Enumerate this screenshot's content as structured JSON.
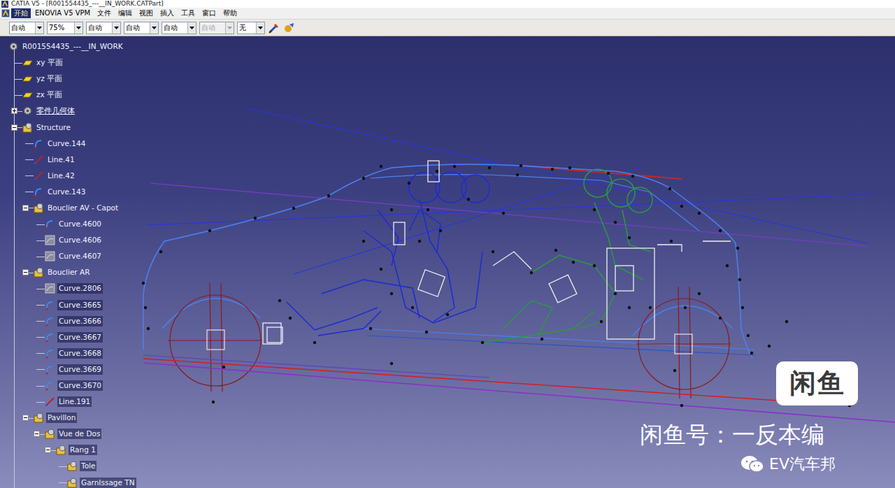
{
  "window": {
    "title": "CATIA V5 - [R001554435_---__IN_WORK.CATPart]"
  },
  "menu": [
    {
      "label": "开始",
      "selected": true
    },
    {
      "label": "ENOVIA V5 VPM",
      "selected": false
    },
    {
      "label": "文件",
      "selected": false
    },
    {
      "label": "编辑",
      "selected": false
    },
    {
      "label": "视图",
      "selected": false
    },
    {
      "label": "插入",
      "selected": false
    },
    {
      "label": "工具",
      "selected": false
    },
    {
      "label": "窗口",
      "selected": false
    },
    {
      "label": "帮助",
      "selected": false
    }
  ],
  "toolbar": {
    "combos": [
      {
        "value": "自动",
        "disabled": false
      },
      {
        "value": "75%",
        "disabled": false
      },
      {
        "value": "自动",
        "disabled": false
      },
      {
        "value": "自动",
        "disabled": false
      },
      {
        "value": "自动",
        "disabled": false
      },
      {
        "value": "自动",
        "disabled": true
      },
      {
        "value": "无",
        "disabled": false
      }
    ]
  },
  "tree": [
    {
      "label": "R001554435_---__IN_WORK",
      "level": 0,
      "kind": "part",
      "hidden": false,
      "expandable": false,
      "expanded": false,
      "selected": false,
      "current": false
    },
    {
      "label": "xy 平面",
      "level": 1,
      "kind": "plane",
      "hidden": false,
      "expandable": false,
      "expanded": false,
      "selected": false,
      "current": false
    },
    {
      "label": "yz 平面",
      "level": 1,
      "kind": "plane",
      "hidden": false,
      "expandable": false,
      "expanded": false,
      "selected": false,
      "current": false
    },
    {
      "label": "zx 平面",
      "level": 1,
      "kind": "plane",
      "hidden": false,
      "expandable": false,
      "expanded": false,
      "selected": false,
      "current": false
    },
    {
      "label": "零件几何体",
      "level": 1,
      "kind": "body",
      "hidden": false,
      "expandable": true,
      "expanded": false,
      "selected": false,
      "current": true
    },
    {
      "label": "Structure",
      "level": 1,
      "kind": "geoset",
      "hidden": false,
      "expandable": true,
      "expanded": true,
      "selected": false,
      "current": false
    },
    {
      "label": "Curve.144",
      "level": 2,
      "kind": "curve",
      "hidden": false,
      "expandable": false,
      "expanded": false,
      "selected": false,
      "current": false
    },
    {
      "label": "Line.41",
      "level": 2,
      "kind": "line",
      "hidden": false,
      "expandable": false,
      "expanded": false,
      "selected": false,
      "current": false
    },
    {
      "label": "Line.42",
      "level": 2,
      "kind": "line",
      "hidden": false,
      "expandable": false,
      "expanded": false,
      "selected": false,
      "current": false
    },
    {
      "label": "Curve.143",
      "level": 2,
      "kind": "curve",
      "hidden": false,
      "expandable": false,
      "expanded": false,
      "selected": false,
      "current": false
    },
    {
      "label": "Bouclier AV - Capot",
      "level": 2,
      "kind": "geoset",
      "hidden": false,
      "expandable": true,
      "expanded": true,
      "selected": false,
      "current": false
    },
    {
      "label": "Curve.4600",
      "level": 3,
      "kind": "curve",
      "hidden": false,
      "expandable": false,
      "expanded": false,
      "selected": false,
      "current": false
    },
    {
      "label": "Curve.4606",
      "level": 3,
      "kind": "curve",
      "hidden": true,
      "expandable": false,
      "expanded": false,
      "selected": false,
      "current": false
    },
    {
      "label": "Curve.4607",
      "level": 3,
      "kind": "curve",
      "hidden": true,
      "expandable": false,
      "expanded": false,
      "selected": false,
      "current": false
    },
    {
      "label": "Bouclier AR",
      "level": 2,
      "kind": "geoset",
      "hidden": false,
      "expandable": true,
      "expanded": true,
      "selected": false,
      "current": false
    },
    {
      "label": "Curve.2806",
      "level": 3,
      "kind": "curve",
      "hidden": true,
      "expandable": false,
      "expanded": false,
      "selected": true,
      "current": false
    },
    {
      "label": "Curve.3665",
      "level": 3,
      "kind": "curve",
      "hidden": false,
      "expandable": false,
      "expanded": false,
      "selected": true,
      "current": false
    },
    {
      "label": "Curve.3666",
      "level": 3,
      "kind": "curve",
      "hidden": false,
      "expandable": false,
      "expanded": false,
      "selected": true,
      "current": false
    },
    {
      "label": "Curve.3667",
      "level": 3,
      "kind": "curve",
      "hidden": false,
      "expandable": false,
      "expanded": false,
      "selected": true,
      "current": false
    },
    {
      "label": "Curve.3668",
      "level": 3,
      "kind": "curve",
      "hidden": false,
      "expandable": false,
      "expanded": false,
      "selected": true,
      "current": false
    },
    {
      "label": "Curve.3669",
      "level": 3,
      "kind": "curve",
      "hidden": false,
      "expandable": false,
      "expanded": false,
      "selected": true,
      "current": false
    },
    {
      "label": "Curve.3670",
      "level": 3,
      "kind": "curve",
      "hidden": false,
      "expandable": false,
      "expanded": false,
      "selected": true,
      "current": false
    },
    {
      "label": "Line.191",
      "level": 3,
      "kind": "line",
      "hidden": false,
      "expandable": false,
      "expanded": false,
      "selected": true,
      "current": false
    },
    {
      "label": "Pavillon",
      "level": 2,
      "kind": "geoset",
      "hidden": false,
      "expandable": true,
      "expanded": true,
      "selected": true,
      "current": false
    },
    {
      "label": "Vue de Dos",
      "level": 3,
      "kind": "geoset",
      "hidden": false,
      "expandable": true,
      "expanded": true,
      "selected": true,
      "current": false
    },
    {
      "label": "Rang 1",
      "level": 4,
      "kind": "geoset",
      "hidden": false,
      "expandable": true,
      "expanded": true,
      "selected": true,
      "current": false
    },
    {
      "label": "Tole",
      "level": 5,
      "kind": "geoset",
      "hidden": false,
      "expandable": false,
      "expanded": false,
      "selected": true,
      "current": false
    },
    {
      "label": "GarnIssage TN",
      "level": 5,
      "kind": "geoset",
      "hidden": false,
      "expandable": false,
      "expanded": false,
      "selected": true,
      "current": false
    }
  ],
  "watermark": {
    "logo": "闲鱼",
    "account": "闲鱼号：一反本编",
    "channel": "EV汽车邦"
  }
}
